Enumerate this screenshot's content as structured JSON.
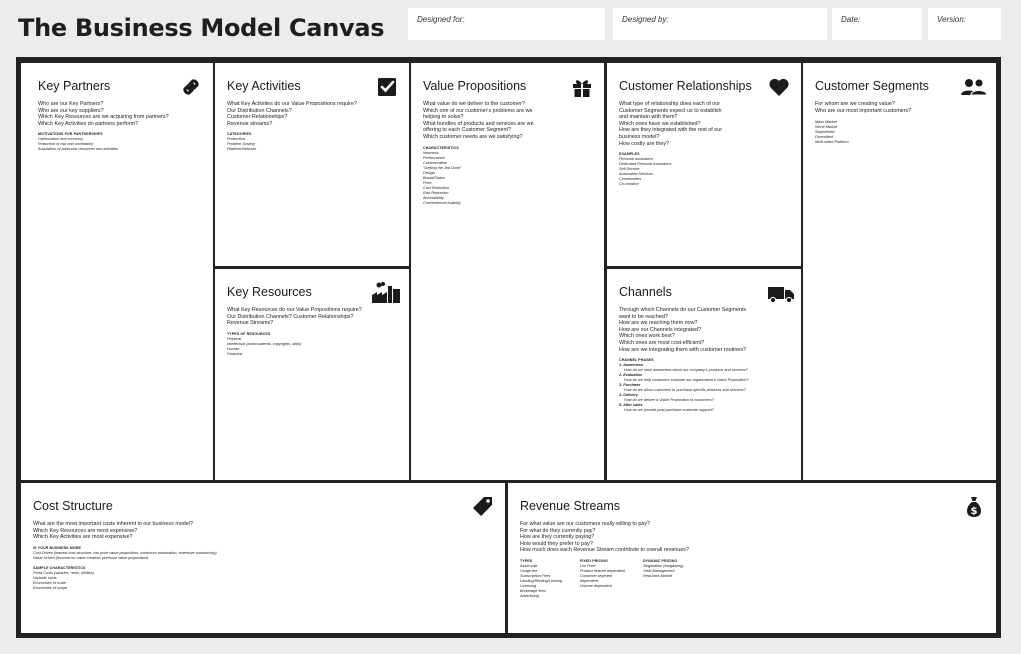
{
  "title": "The Business Model Canvas",
  "header_fields": {
    "designed_for": "Designed for:",
    "designed_by": "Designed by:",
    "date": "Date:",
    "version": "Version:"
  },
  "key_partners": {
    "heading": "Key Partners",
    "icon": "link-icon",
    "questions": [
      "Who are our Key Partners?",
      "Who are our key suppliers?",
      "Which Key Resources are we acquiring from partners?",
      "Which Key Activities do partners perform?"
    ],
    "subheading": "MOTIVATIONS FOR PARTNERSHIPS",
    "items": [
      "Optimization and economy",
      "Reduction of risk and uncertainty",
      "Acquisition of particular resources and activities"
    ]
  },
  "key_activities": {
    "heading": "Key Activities",
    "icon": "checkbox-icon",
    "questions": [
      "What Key Activities do our Value Propositions require?",
      "Our Distribution Channels?",
      "Customer Relationships?",
      "Revenue streams?"
    ],
    "subheading": "CATEGORIES",
    "items": [
      "Production",
      "Problem Solving",
      "Platform/Network"
    ]
  },
  "key_resources": {
    "heading": "Key Resources",
    "icon": "factory-icon",
    "questions": [
      "What Key Resources do our Value Propositions require?",
      "Our Distribution Channels? Customer Relationships?",
      "Revenue Streams?"
    ],
    "subheading": "TYPES OF RESOURCES",
    "items": [
      "Physical",
      "Intellectual (brand patents, copyrights, data)",
      "Human",
      "Financial"
    ]
  },
  "value_propositions": {
    "heading": "Value Propositions",
    "icon": "gift-icon",
    "questions": [
      "What value do we deliver to the customer?",
      "Which one of our customer's problems are we",
      "helping to solve?",
      "What bundles of products and services are we",
      "offering to each Customer Segment?",
      "Which customer needs are we satisfying?"
    ],
    "subheading": "CHARACTERISTICS",
    "items": [
      "Newness",
      "Performance",
      "Customization",
      "\"Getting the Job Done\"",
      "Design",
      "Brand/Status",
      "Price",
      "Cost Reduction",
      "Risk Reduction",
      "Accessibility",
      "Convenience/Usability"
    ]
  },
  "customer_relationships": {
    "heading": "Customer Relationships",
    "icon": "heart-icon",
    "questions": [
      "What type of relationship does each of our",
      "Customer Segments expect us to establish",
      "and maintain with them?",
      "Which ones have we established?",
      "How are they integrated with the rest of our",
      "business model?",
      "How costly are they?"
    ],
    "subheading": "EXAMPLES",
    "items": [
      "Personal assistance",
      "Dedicated Personal Assistance",
      "Self-Service",
      "Automated Services",
      "Communities",
      "Co-creation"
    ]
  },
  "channels": {
    "heading": "Channels",
    "icon": "truck-icon",
    "questions": [
      "Through which Channels do our Customer Segments",
      "want to be reached?",
      "How are we reaching them now?",
      "How are our Channels integrated?",
      "Which ones work best?",
      "Which ones are most cost-efficient?",
      "How are we integrating them with customer routines?"
    ],
    "subheading": "CHANNEL PHASES",
    "phases": [
      {
        "label": "1. Awareness",
        "detail": "How do we raise awareness about our company's products and services?"
      },
      {
        "label": "2. Evaluation",
        "detail": "How do we help customers evaluate our organization's Value Proposition?"
      },
      {
        "label": "3. Purchase",
        "detail": "How do we allow customers to purchase specific products and services?"
      },
      {
        "label": "4. Delivery",
        "detail": "How do we deliver a Value Proposition to customers?"
      },
      {
        "label": "5. After sales",
        "detail": "How do we provide post-purchase customer support?"
      }
    ]
  },
  "customer_segments": {
    "heading": "Customer Segments",
    "icon": "users-icon",
    "questions": [
      "For whom are we creating value?",
      "Who are our most important customers?"
    ],
    "items": [
      "Mass Market",
      "Niche Market",
      "Segmented",
      "Diversified",
      "Multi-sided Platform"
    ]
  },
  "cost_structure": {
    "heading": "Cost Structure",
    "icon": "price-tag-icon",
    "questions": [
      "What are the most important costs inherent in our business model?",
      "Which Key Resources are most expensive?",
      "Which Key Activities are most expensive?"
    ],
    "subheading": "IS YOUR BUSINESS MORE",
    "items": [
      "Cost Driven (leanest cost structure, low price value proposition, maximum automation, extensive outsourcing)",
      "Value Driven (focused on value creation, premium value proposition)"
    ],
    "subheading2": "SAMPLE CHARACTERISTICS",
    "items2": [
      "Fixed Costs (salaries, rents, utilities)",
      "Variable costs",
      "Economies of scale",
      "Economies of scope"
    ]
  },
  "revenue_streams": {
    "heading": "Revenue Streams",
    "icon": "money-bag-icon",
    "questions": [
      "For what value are our customers really willing to pay?",
      "For what do they currently pay?",
      "How are they currently paying?",
      "How would they prefer to pay?",
      "How much does each Revenue Stream contribute to overall revenues?"
    ],
    "columns": [
      {
        "subheading": "TYPES",
        "items": [
          "Asset sale",
          "Usage fee",
          "Subscription Fees",
          "Lending/Renting/Leasing",
          "Licensing",
          "Brokerage fees",
          "Advertising"
        ]
      },
      {
        "subheading": "FIXED PRICING",
        "items": [
          "List Price",
          "Product feature dependent",
          "Customer segment",
          "dependent",
          "Volume dependent"
        ]
      },
      {
        "subheading": "DYNAMIC PRICING",
        "items": [
          "Negotiation (bargaining)",
          "Yield Management",
          "Real-time-Market"
        ]
      }
    ]
  }
}
